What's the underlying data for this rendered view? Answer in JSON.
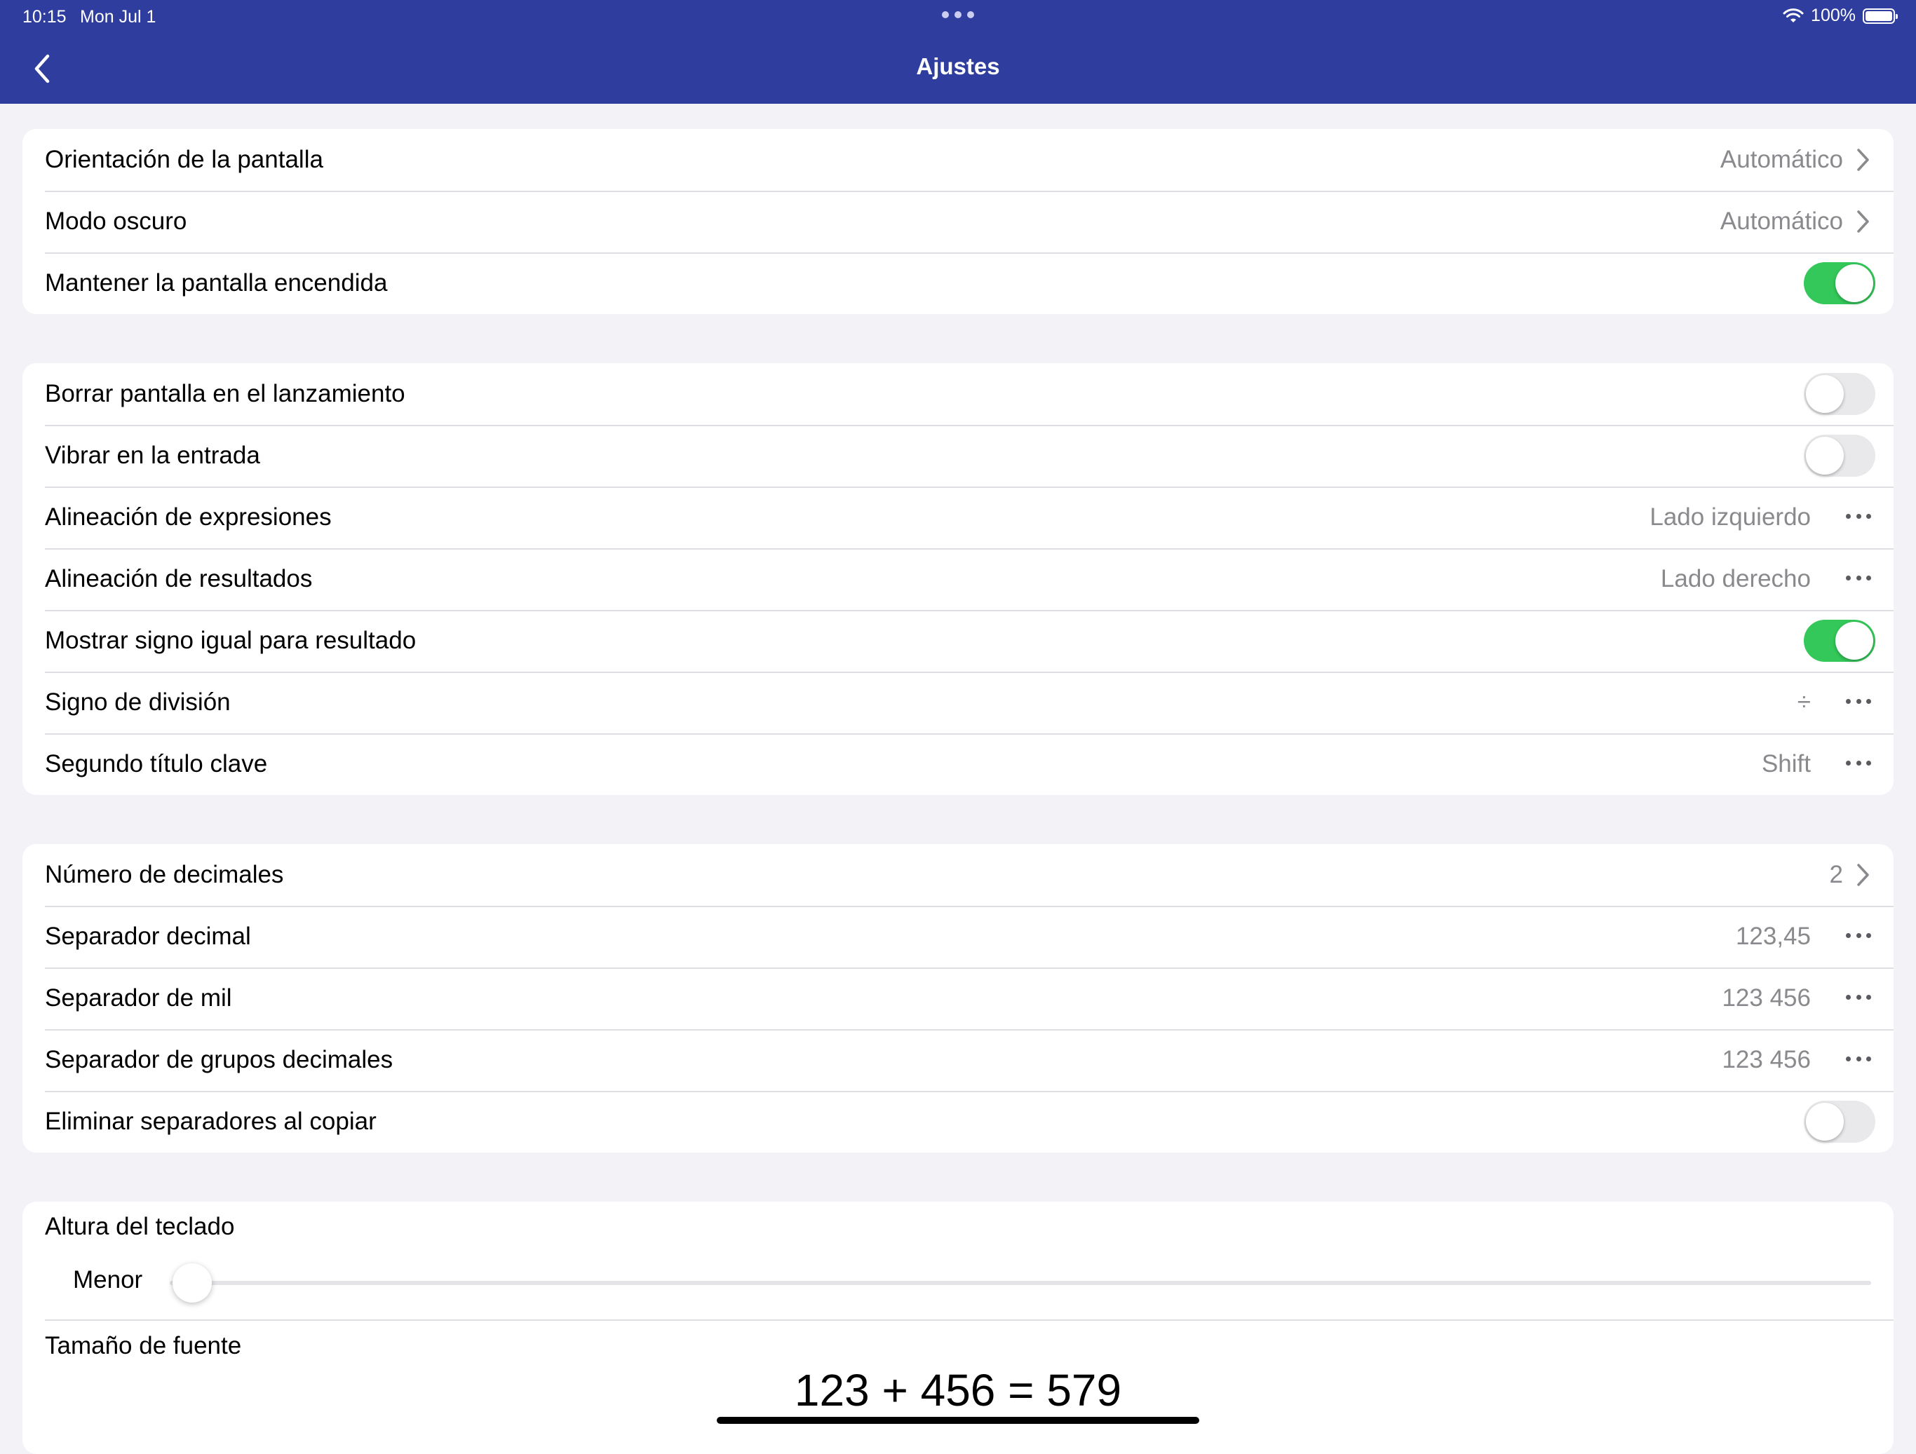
{
  "status_bar": {
    "time": "10:15",
    "date": "Mon Jul 1",
    "battery": "100%"
  },
  "nav": {
    "title": "Ajustes",
    "back_icon": "chevron-left-icon"
  },
  "colors": {
    "nav_background": "#2e3d9e",
    "toggle_on": "#34c759",
    "toggle_off": "#e9e9eb",
    "page_background": "#f2f2f7"
  },
  "group1": {
    "rows": [
      {
        "label": "Orientación de la pantalla",
        "value": "Automático",
        "accessory": "chevron-right-icon"
      },
      {
        "label": "Modo oscuro",
        "value": "Automático",
        "accessory": "chevron-right-icon"
      },
      {
        "label": "Mantener la pantalla encendida",
        "toggle": true
      }
    ]
  },
  "group2": {
    "rows": [
      {
        "label": "Borrar pantalla en el lanzamiento",
        "toggle": false
      },
      {
        "label": "Vibrar en la entrada",
        "toggle": false
      },
      {
        "label": "Alineación de expresiones",
        "value": "Lado izquierdo",
        "accessory": "more-icon"
      },
      {
        "label": "Alineación de resultados",
        "value": "Lado derecho",
        "accessory": "more-icon"
      },
      {
        "label": "Mostrar signo igual para resultado",
        "toggle": true
      },
      {
        "label": "Signo de división",
        "value": "÷",
        "accessory": "more-icon"
      },
      {
        "label": "Segundo título clave",
        "value": "Shift",
        "accessory": "more-icon"
      }
    ]
  },
  "group3": {
    "rows": [
      {
        "label": "Número de decimales",
        "value": "2",
        "accessory": "chevron-right-icon"
      },
      {
        "label": "Separador decimal",
        "value": "123,45",
        "accessory": "more-icon"
      },
      {
        "label": "Separador de mil",
        "value": "123 456",
        "accessory": "more-icon"
      },
      {
        "label": "Separador de grupos decimales",
        "value": "123 456",
        "accessory": "more-icon"
      },
      {
        "label": "Eliminar separadores al copiar",
        "toggle": false
      }
    ]
  },
  "group4": {
    "keyboard_height_label": "Altura del teclado",
    "slider_min_label": "Menor",
    "slider_level": 0,
    "font_size_label": "Tamaño de fuente",
    "font_preview": "123 + 456 = 579"
  }
}
